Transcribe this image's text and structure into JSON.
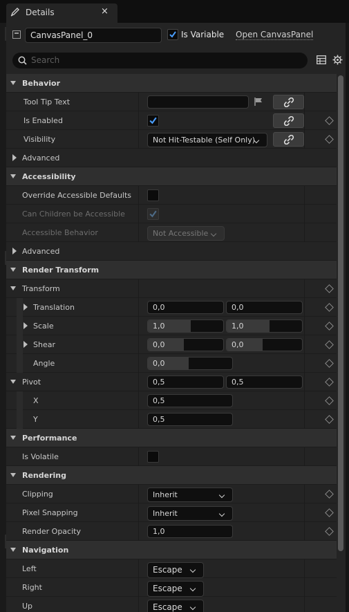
{
  "tab": {
    "title": "Details",
    "close": "×"
  },
  "object": {
    "name": "CanvasPanel_0",
    "is_variable_label": "Is Variable",
    "is_variable": true,
    "open_link": "Open CanvasPanel"
  },
  "search": {
    "placeholder": "Search"
  },
  "sections": {
    "behavior": "Behavior",
    "accessibility": "Accessibility",
    "advanced": "Advanced",
    "render_transform": "Render Transform",
    "transform": "Transform",
    "performance": "Performance",
    "rendering": "Rendering",
    "navigation": "Navigation"
  },
  "props": {
    "tooltip": {
      "label": "Tool Tip Text",
      "value": ""
    },
    "is_enabled": {
      "label": "Is Enabled",
      "checked": true
    },
    "visibility": {
      "label": "Visibility",
      "value": "Not Hit-Testable (Self Only)"
    },
    "override_acc": {
      "label": "Override Accessible Defaults",
      "checked": false
    },
    "children_acc": {
      "label": "Can Children be Accessible",
      "checked": true
    },
    "acc_behavior": {
      "label": "Accessible Behavior",
      "value": "Not Accessible"
    },
    "translation": {
      "label": "Translation",
      "x": "0,0",
      "y": "0,0"
    },
    "scale": {
      "label": "Scale",
      "x": "1,0",
      "y": "1,0"
    },
    "shear": {
      "label": "Shear",
      "x": "0,0",
      "y": "0,0"
    },
    "angle": {
      "label": "Angle",
      "value": "0,0"
    },
    "pivot": {
      "label": "Pivot",
      "x": "0,5",
      "y": "0,5"
    },
    "pivot_x": {
      "label": "X",
      "value": "0,5"
    },
    "pivot_y": {
      "label": "Y",
      "value": "0,5"
    },
    "is_volatile": {
      "label": "Is Volatile",
      "checked": false
    },
    "clipping": {
      "label": "Clipping",
      "value": "Inherit"
    },
    "pixel_snapping": {
      "label": "Pixel Snapping",
      "value": "Inherit"
    },
    "render_opacity": {
      "label": "Render Opacity",
      "value": "1,0"
    },
    "nav_left": {
      "label": "Left",
      "value": "Escape"
    },
    "nav_right": {
      "label": "Right",
      "value": "Escape"
    },
    "nav_up": {
      "label": "Up",
      "value": "Escape"
    }
  },
  "icons": {
    "tab": "pencil-icon",
    "close": "close-icon",
    "object": "widget-icon",
    "search": "search-icon",
    "table": "table-view-icon",
    "settings": "gear-icon",
    "bind": "link-icon",
    "reset": "diamond-keyframe-icon",
    "flag": "flag-icon"
  },
  "colors": {
    "accent": "#4a9eff",
    "background": "#242424",
    "category": "#2f2f2f",
    "input": "#0f0f0f"
  }
}
